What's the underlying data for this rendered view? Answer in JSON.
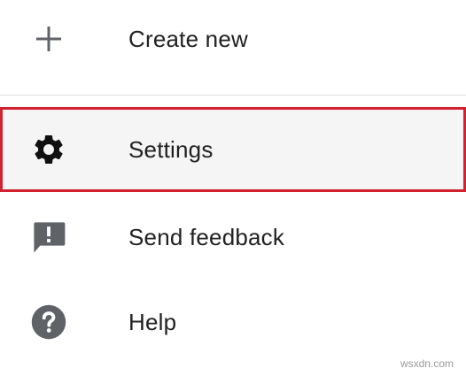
{
  "menu": {
    "items": [
      {
        "label": "Create new",
        "icon": "plus-icon"
      },
      {
        "label": "Settings",
        "icon": "gear-icon",
        "highlighted": true
      },
      {
        "label": "Send feedback",
        "icon": "feedback-icon"
      },
      {
        "label": "Help",
        "icon": "help-icon"
      }
    ]
  },
  "colors": {
    "highlight_border": "#d3222f",
    "highlight_background": "#f5f5f5",
    "icon": "#5f6368",
    "text": "#212121"
  },
  "watermark": "wsxdn.com"
}
